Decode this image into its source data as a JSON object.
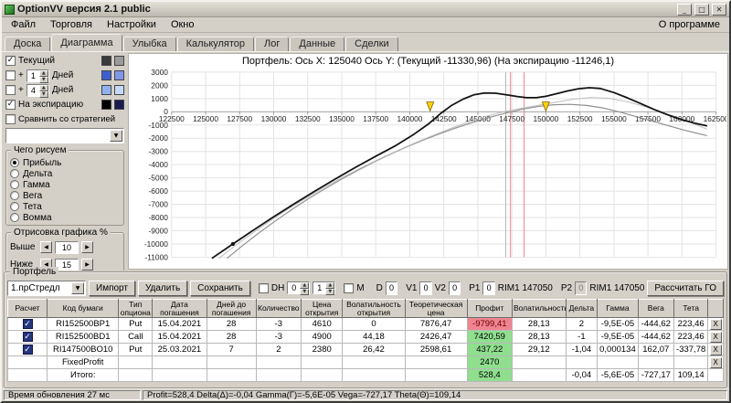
{
  "window": {
    "title": "OptionVV версия 2.1 public",
    "buttons": {
      "minimize": "_",
      "maximize": "□",
      "close": "✕"
    }
  },
  "menu": {
    "items": [
      "Файл",
      "Торговля",
      "Настройки",
      "Окно"
    ],
    "right": "О программе"
  },
  "tabs": {
    "items": [
      "Доска",
      "Диаграмма",
      "Улыбка",
      "Калькулятор",
      "Лог",
      "Данные",
      "Сделки"
    ],
    "active": "Диаграмма"
  },
  "sidebar": {
    "current": {
      "label": "Текущий",
      "checked": true,
      "colors": [
        "#3a3a3a",
        "#9a9a9a"
      ]
    },
    "plus1": {
      "prefix": "+",
      "value": "1",
      "suffix": "Дней",
      "checked": false,
      "colors": [
        "#3f5fd0",
        "#7e97e6"
      ]
    },
    "plus4": {
      "prefix": "+",
      "value": "4",
      "suffix": "Дней",
      "checked": false,
      "colors": [
        "#8fb2ee",
        "#c7d9f8"
      ]
    },
    "expiration": {
      "label": "На экспирацию",
      "checked": true,
      "colors": [
        "#000000",
        "#1a1a52"
      ]
    },
    "compare": {
      "label": "Сравнить со стратегией",
      "checked": false
    },
    "strategy_select_value": "",
    "draw_group": {
      "title": "Чего рисуем",
      "options": [
        "Прибыль",
        "Дельта",
        "Гамма",
        "Вега",
        "Тета",
        "Вомма"
      ],
      "selected": "Прибыль"
    },
    "render_group": {
      "title": "Отрисовка графика %",
      "above_label": "Выше",
      "above_value": "10",
      "below_label": "Ниже",
      "below_value": "15"
    }
  },
  "chart_data": {
    "type": "line",
    "title": "Портфель: Ось X: 125040 Ось Y:  (Текущий -11330,96)  (На экспирацию -11246,1)",
    "xlim": [
      122500,
      162500
    ],
    "ylim": [
      -11000,
      3000
    ],
    "x_ticks": [
      122500,
      125000,
      127500,
      130000,
      132500,
      135000,
      137500,
      140000,
      142500,
      145000,
      147500,
      150000,
      152500,
      155000,
      157500,
      160000,
      162500
    ],
    "y_ticks": [
      3000,
      2000,
      1000,
      0,
      -1000,
      -2000,
      -3000,
      -4000,
      -5000,
      -6000,
      -7000,
      -8000,
      -9000,
      -10000,
      -11000
    ],
    "grid": true,
    "legend": "none",
    "series": [
      {
        "name": "current",
        "color": "#8f8f8f",
        "width": 1.2,
        "points": [
          [
            126600,
            -11060
          ],
          [
            127800,
            -10050
          ],
          [
            129000,
            -9100
          ],
          [
            130200,
            -8200
          ],
          [
            131400,
            -7350
          ],
          [
            132600,
            -6550
          ],
          [
            133800,
            -5800
          ],
          [
            135000,
            -5090
          ],
          [
            136200,
            -4420
          ],
          [
            137400,
            -3790
          ],
          [
            138600,
            -3200
          ],
          [
            139800,
            -2650
          ],
          [
            141000,
            -2140
          ],
          [
            142200,
            -1660
          ],
          [
            143400,
            -1220
          ],
          [
            144600,
            -810
          ],
          [
            145800,
            -440
          ],
          [
            147000,
            -110
          ],
          [
            148200,
            180
          ],
          [
            149400,
            400
          ],
          [
            150600,
            530
          ],
          [
            151800,
            560
          ],
          [
            153000,
            480
          ],
          [
            154200,
            290
          ],
          [
            155400,
            -10
          ],
          [
            156600,
            -350
          ],
          [
            157800,
            -700
          ],
          [
            159000,
            -1050
          ],
          [
            160200,
            -1400
          ],
          [
            161800,
            -1800
          ]
        ]
      },
      {
        "name": "aux-days",
        "color": "#bdbdbd",
        "width": 1,
        "points": [
          [
            126000,
            -11060
          ],
          [
            127300,
            -10030
          ],
          [
            128600,
            -9060
          ],
          [
            129900,
            -8140
          ],
          [
            131200,
            -7270
          ],
          [
            132500,
            -6450
          ],
          [
            133800,
            -5670
          ],
          [
            135100,
            -4940
          ],
          [
            136400,
            -4250
          ],
          [
            137700,
            -3600
          ],
          [
            139000,
            -2980
          ],
          [
            140300,
            -2390
          ],
          [
            141600,
            -1830
          ],
          [
            142900,
            -1300
          ],
          [
            144200,
            -810
          ],
          [
            145500,
            -380
          ],
          [
            146800,
            -20
          ],
          [
            148100,
            250
          ],
          [
            149400,
            480
          ],
          [
            150700,
            720
          ],
          [
            152000,
            950
          ],
          [
            153300,
            1080
          ],
          [
            154600,
            1020
          ],
          [
            155900,
            780
          ],
          [
            157200,
            420
          ],
          [
            158500,
            -10
          ],
          [
            159800,
            -470
          ],
          [
            161800,
            -1300
          ]
        ]
      },
      {
        "name": "expiration",
        "color": "#141414",
        "width": 1.8,
        "start_dot": true,
        "points": [
          [
            125500,
            -11060
          ],
          [
            127000,
            -10000
          ],
          [
            128500,
            -8960
          ],
          [
            130000,
            -7950
          ],
          [
            131500,
            -6970
          ],
          [
            133000,
            -6020
          ],
          [
            134500,
            -5100
          ],
          [
            136000,
            -4210
          ],
          [
            137500,
            -3360
          ],
          [
            139000,
            -2540
          ],
          [
            140300,
            -1700
          ],
          [
            141400,
            -900
          ],
          [
            142300,
            -100
          ],
          [
            143100,
            500
          ],
          [
            143900,
            950
          ],
          [
            144700,
            1280
          ],
          [
            145500,
            1420
          ],
          [
            146300,
            1400
          ],
          [
            147100,
            1290
          ],
          [
            147900,
            1150
          ],
          [
            148600,
            1070
          ],
          [
            149300,
            1070
          ],
          [
            150000,
            1170
          ],
          [
            150800,
            1370
          ],
          [
            151600,
            1580
          ],
          [
            152400,
            1740
          ],
          [
            153200,
            1820
          ],
          [
            154000,
            1760
          ],
          [
            155000,
            1450
          ],
          [
            156000,
            1050
          ],
          [
            157000,
            600
          ],
          [
            158000,
            150
          ],
          [
            159000,
            -250
          ],
          [
            160000,
            -600
          ],
          [
            161000,
            -880
          ],
          [
            161800,
            -1060
          ]
        ]
      }
    ],
    "vlines": [
      {
        "x": 147050,
        "color": "#b4b4b4"
      },
      {
        "x": 147400,
        "color": "#f2808e"
      },
      {
        "x": 148400,
        "color": "#f2808e"
      }
    ],
    "markers": [
      {
        "x": 141500,
        "y": 60,
        "color": "#ffd400"
      },
      {
        "x": 150000,
        "y": 60,
        "color": "#ffd400"
      }
    ]
  },
  "portfolio": {
    "group_title": "Портфель",
    "toolbar": {
      "preset": "1.прСтредл",
      "import": "Импорт",
      "delete": "Удалить",
      "save": "Сохранить",
      "dh_label": "DH",
      "dh_val1": "0",
      "dh_val2": "1",
      "m_label": "M",
      "d_label": "D",
      "d_value": "0",
      "v1_label": "V1",
      "v1_value": "0",
      "v2_label": "V2",
      "v2_value": "0",
      "p1_label": "P1",
      "p1_value": "0",
      "rim1_label": "RIM1 147050",
      "p2_label": "P2",
      "p2_value": "0",
      "rim2_label": "RIM1 147050",
      "calc_button": "Рассчитать ГО"
    },
    "table": {
      "delete_label": "X",
      "columns": [
        "Расчет",
        "Код бумаги",
        "Тип опциона",
        "Дата погашения",
        "Дней до погашения",
        "Количество",
        "Цена открытия",
        "Волатильность открытия",
        "Теоретическая цена",
        "Профит",
        "Волатильность",
        "Дельта",
        "Гамма",
        "Вега",
        "Тета",
        ""
      ],
      "rows": [
        {
          "checkbox": true,
          "checked": true,
          "deletable": true,
          "profit_state": "loss",
          "cells": [
            "RI152500BP1",
            "Put",
            "15.04.2021",
            "28",
            "-3",
            "4610",
            "0",
            "7876,47",
            "-9799,41",
            "28,13",
            "2",
            "-9,5E-05",
            "-444,62",
            "223,46"
          ]
        },
        {
          "checkbox": true,
          "checked": true,
          "deletable": true,
          "profit_state": "gain",
          "cells": [
            "RI152500BD1",
            "Call",
            "15.04.2021",
            "28",
            "-3",
            "4900",
            "44,18",
            "2426,47",
            "7420,59",
            "28,13",
            "-1",
            "-9,5E-05",
            "-444,62",
            "223,46"
          ]
        },
        {
          "checkbox": true,
          "checked": true,
          "deletable": true,
          "profit_state": "gain",
          "cells": [
            "RI147500BO10",
            "Put",
            "25.03.2021",
            "7",
            "2",
            "2380",
            "26,42",
            "2598,61",
            "437,22",
            "29,12",
            "-1,04",
            "0,000134",
            "162,07",
            "-337,78"
          ]
        },
        {
          "checkbox": false,
          "checked": false,
          "deletable": true,
          "profit_state": "gain",
          "cells": [
            "FixedProfit",
            "",
            "",
            "",
            "",
            "",
            "",
            "",
            "2470",
            "",
            "",
            "",
            "",
            ""
          ]
        },
        {
          "checkbox": false,
          "checked": false,
          "deletable": false,
          "profit_state": "gain",
          "cells": [
            "Итого:",
            "",
            "",
            "",
            "",
            "",
            "",
            "",
            "528,4",
            "",
            "-0,04",
            "-5,6E-05",
            "-727,17",
            "109,14"
          ]
        }
      ]
    }
  },
  "statusbar": {
    "update_time": "Время обновления 27 мс",
    "greeks": "Profit=528,4 Delta(Δ)=-0,04 Gamma(Γ)=-5,6E-05 Vega=-727,17 Theta(Θ)=109,14"
  }
}
